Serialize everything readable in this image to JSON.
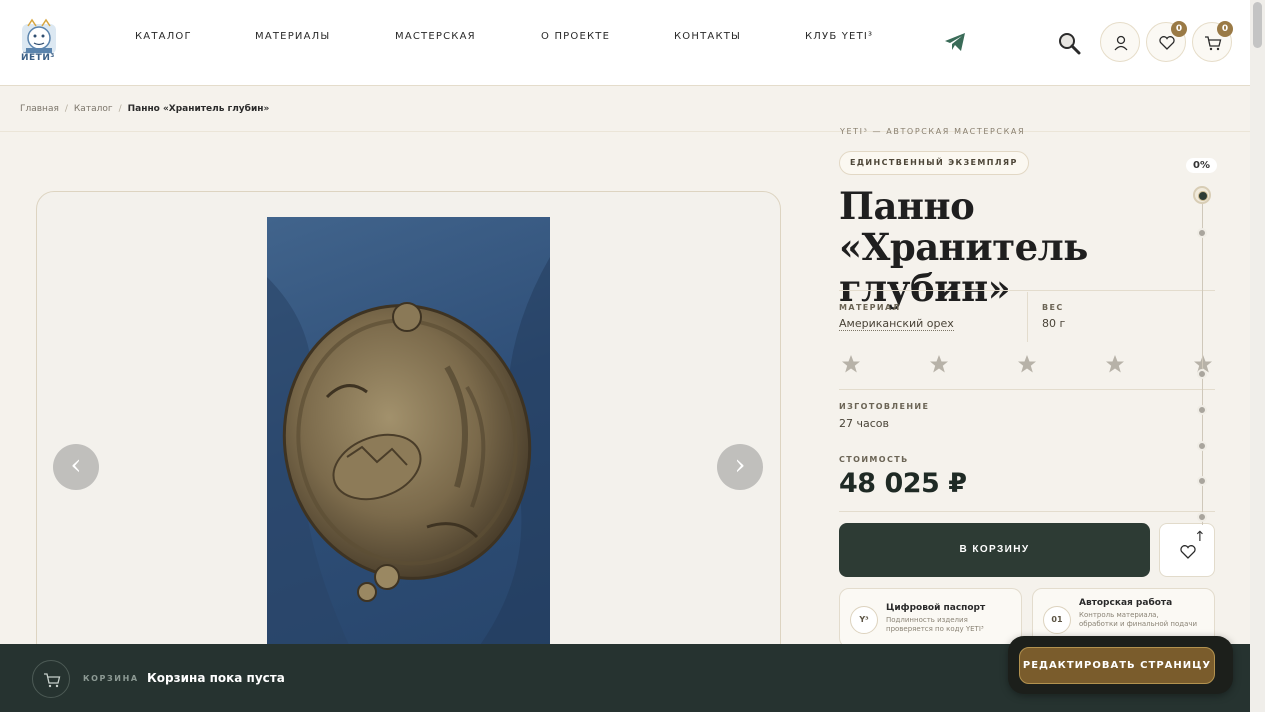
{
  "header": {
    "logo_text": "ЙЕТИ³",
    "nav": [
      "КАТАЛОГ",
      "МАТЕРИАЛЫ",
      "МАСТЕРСКАЯ",
      "О ПРОЕКТЕ",
      "КОНТАКТЫ",
      "КЛУБ YETI³"
    ],
    "icons": [
      "telegram-icon",
      "search-icon",
      "user-icon",
      "heart-icon",
      "cart-icon"
    ],
    "wishlist_count": "0",
    "cart_count": "0"
  },
  "breadcrumb": {
    "items": [
      "Главная",
      "Каталог"
    ],
    "current": "Панно «Хранитель глубин»"
  },
  "gallery": {
    "prev": "‹",
    "next": "›"
  },
  "product": {
    "eyebrow": "YETI³ — АВТОРСКАЯ МАСТЕРСКАЯ",
    "badge": "ЕДИНСТВЕННЫЙ ЭКЗЕМПЛЯР",
    "title": "Панно «Хранитель глубин»",
    "material_label": "МАТЕРИАЛ",
    "material_value": "Американский орех",
    "weight_label": "ВЕС",
    "weight_value": "80 г",
    "rating_stars": 5,
    "production_label": "ИЗГОТОВЛЕНИЕ",
    "production_value": "27 часов",
    "price_label": "СТОИМОСТЬ",
    "price": "48 025 ₽",
    "add_to_cart": "В КОРЗИНУ",
    "features": [
      {
        "icon": "Y³",
        "title": "Цифровой паспорт",
        "text": "Подлинность изделия проверяется по коду YETI³"
      },
      {
        "icon": "01",
        "title": "Авторская работа",
        "text": "Контроль материала, обработки и финальной подачи"
      }
    ]
  },
  "progress": {
    "percent": "0%",
    "top_arrow": "↑"
  },
  "cart_bar": {
    "label": "КОРЗИНА",
    "text": "Корзина пока пуста",
    "edit_button": "РЕДАКТИРОВАТЬ СТРАНИЦУ"
  },
  "colors": {
    "accent_dark": "#2d3b34",
    "gold": "#9a7a46",
    "background": "#f5f2ec"
  }
}
